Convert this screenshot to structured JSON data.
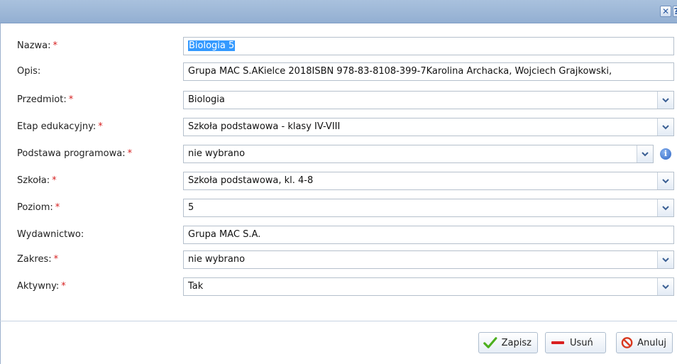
{
  "dialog": {
    "close_glyph": "✕",
    "extra_glyph": "?"
  },
  "form": {
    "required_mark": "*",
    "fields": [
      {
        "label": "Nazwa:",
        "value": "Biologia 5",
        "type": "text",
        "required": true
      },
      {
        "label": "Opis:",
        "value": "Grupa MAC S.AKielce 2018ISBN 978-83-8108-399-7Karolina Archacka, Wojciech Grajkowski,",
        "type": "text",
        "required": false
      },
      {
        "label": "Przedmiot:",
        "value": "Biologia",
        "type": "select",
        "required": true
      },
      {
        "label": "Etap edukacyjny:",
        "value": "Szkoła podstawowa - klasy IV-VIII",
        "type": "select",
        "required": true
      },
      {
        "label": "Podstawa programowa:",
        "value": "nie wybrano",
        "type": "select",
        "required": true
      },
      {
        "label": "Szkoła:",
        "value": "Szkoła podstawowa, kl. 4-8",
        "type": "select",
        "required": true
      },
      {
        "label": "Poziom:",
        "value": "5",
        "type": "select",
        "required": true
      },
      {
        "label": "Wydawnictwo:",
        "value": "Grupa MAC S.A.",
        "type": "text",
        "required": false
      },
      {
        "label": "Zakres:",
        "value": "nie wybrano",
        "type": "select",
        "required": true
      },
      {
        "label": "Aktywny:",
        "value": "Tak",
        "type": "select",
        "required": true
      }
    ]
  },
  "buttons": {
    "save": "Zapisz",
    "delete": "Usuń",
    "cancel": "Anuluj"
  },
  "colors": {
    "required": "#d62020",
    "accent": "#3399ff",
    "save_icon": "#4caf1d",
    "delete_icon": "#d92020",
    "cancel_icon": "#d9381e"
  }
}
